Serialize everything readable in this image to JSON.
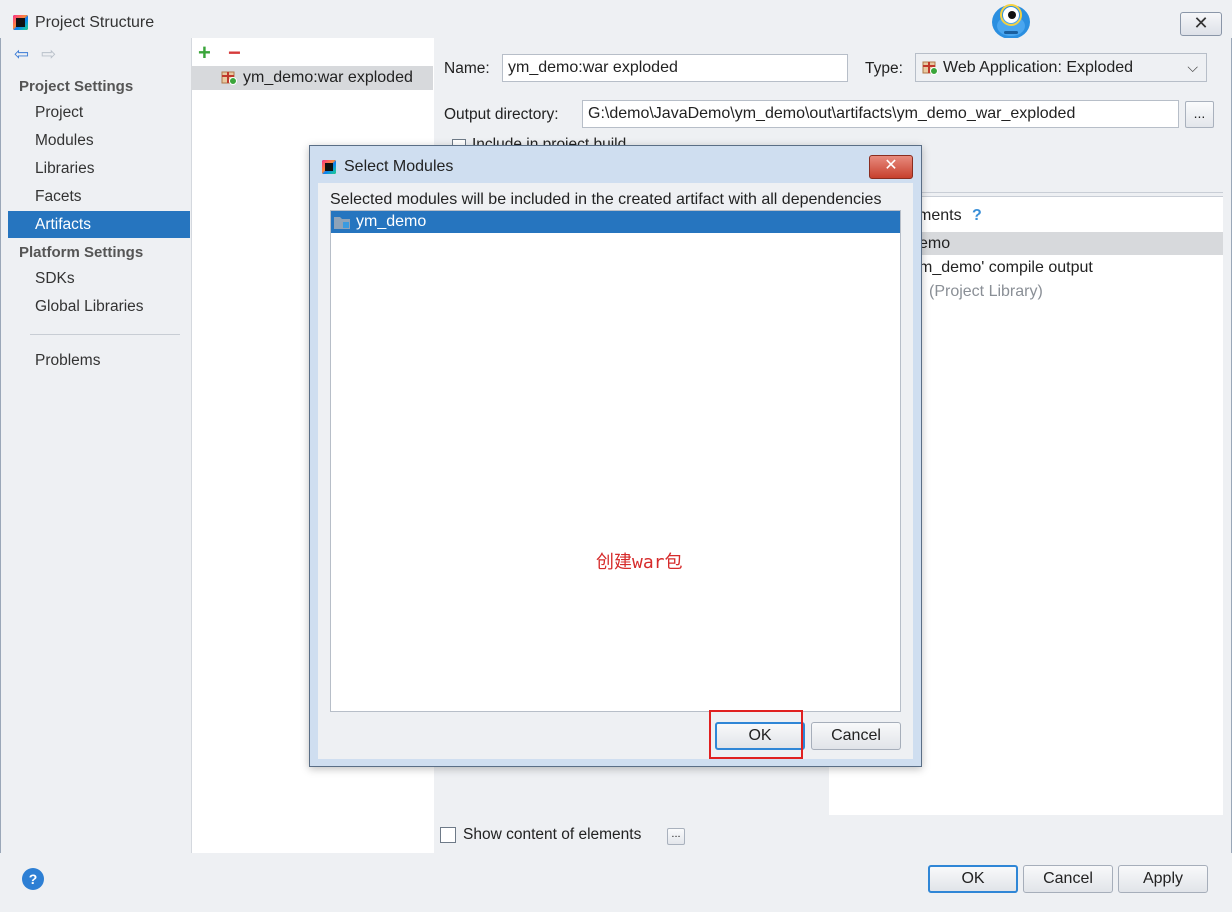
{
  "window": {
    "title": "Project Structure",
    "close_symbol": "✕"
  },
  "nav": {
    "back": "⇦",
    "forward": "⇨"
  },
  "sidebar": {
    "project_settings_heading": "Project Settings",
    "project_items": [
      "Project",
      "Modules",
      "Libraries",
      "Facets",
      "Artifacts"
    ],
    "active_item": "Artifacts",
    "platform_settings_heading": "Platform Settings",
    "platform_items": [
      "SDKs",
      "Global Libraries"
    ],
    "problems": "Problems"
  },
  "artifacts_list": {
    "add_symbol": "+",
    "remove_symbol": "−",
    "items": [
      "ym_demo:war exploded"
    ]
  },
  "artifact_form": {
    "name_label": "Name:",
    "name_value": "ym_demo:war exploded",
    "type_label": "Type:",
    "type_value": "Web Application: Exploded",
    "output_label": "Output directory:",
    "output_value": "G:\\demo\\JavaDemo\\ym_demo\\out\\artifacts\\ym_demo_war_exploded",
    "browse_label": "...",
    "include_label": "Include in project build"
  },
  "elements_panel": {
    "heading": "ments",
    "help": "?",
    "rows": [
      "emo",
      "m_demo' compile output",
      "(Project Library)"
    ]
  },
  "show_content_label": "Show content of elements",
  "show_content_dots": "...",
  "bottom_buttons": {
    "ok": "OK",
    "cancel": "Cancel",
    "apply": "Apply",
    "help": "?"
  },
  "dialog": {
    "title": "Select Modules",
    "close_symbol": "✕",
    "description": "Selected modules will be included in the created artifact with all dependencies",
    "modules": [
      "ym_demo"
    ],
    "ok": "OK",
    "cancel": "Cancel"
  },
  "annotation": "创建war包",
  "colors": {
    "accent": "#2675bf",
    "annotation": "#d62b2b"
  }
}
